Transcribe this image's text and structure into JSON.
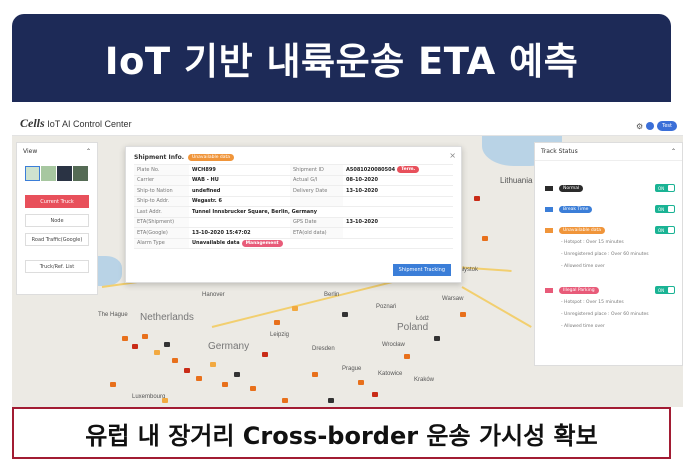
{
  "slide": {
    "title": "IoT 기반 내륙운송 ETA 예측",
    "caption": "유럽 내 장거리 Cross-border 운송 가시성 확보"
  },
  "app": {
    "logo_brand": "Cells",
    "logo_text": "IoT  AI Control Center",
    "header_button": "Test"
  },
  "left_panel": {
    "title": "View",
    "buttons": [
      "Current Truck",
      "Node",
      "Road Traffic(Google)",
      "Truck/Ref. List"
    ]
  },
  "shipment": {
    "title": "Shipment Info.",
    "status_badge": "Unavailable data",
    "rows": [
      {
        "k": "Plate No.",
        "v": "WCH899",
        "k2": "Shipment ID",
        "v2": "A5081020080504",
        "badge": "Term."
      },
      {
        "k": "Carrier",
        "v": "WAB - HU",
        "k2": "Actual G/I",
        "v2": "08-10-2020"
      },
      {
        "k": "Ship-to Nation",
        "v": "undefined",
        "k2": "Delivery Date",
        "v2": "13-10-2020"
      },
      {
        "k": "Ship-to Addr.",
        "v": "Wegastr. 6",
        "k2": "",
        "v2": ""
      },
      {
        "k": "Last Addr.",
        "wide": "Tunnel Innsbrucker Square, Berlin, Germany"
      },
      {
        "k": "ETA(Shipment)",
        "v": "",
        "k2": "GPS Date",
        "v2": "13-10-2020"
      },
      {
        "k": "ETA(Google)",
        "v": "13-10-2020 15:47:02",
        "k2": "ETA(old data)",
        "v2": ""
      },
      {
        "k": "Alarm Type",
        "v": "Unavailable data",
        "badge_v": "Management"
      }
    ],
    "track_button": "Shipment Tracking"
  },
  "track_status": {
    "title": "Track Status",
    "items": [
      {
        "label": "Normal",
        "color": "#2b2b2b",
        "toggle": "ON"
      },
      {
        "label": "Break Time",
        "color": "#3b7ed8",
        "toggle": "ON"
      },
      {
        "label": "Unavailable data",
        "color": "#f0953a",
        "toggle": "ON",
        "subs": [
          "- Hotspot : Over 15 minutes",
          "- Unregistered place : Over 60 minutes",
          "- Allowed time over"
        ]
      },
      {
        "label": "Illegal Parking",
        "color": "#e85b79",
        "toggle": "ON",
        "subs": [
          "- Hotspot : Over 15 minutes",
          "- Unregistered place : Over 60 minutes",
          "- Allowed time over"
        ]
      }
    ]
  },
  "map": {
    "cities": [
      "Lithuania",
      "Białystok",
      "The Hague",
      "Netherlands",
      "Germany",
      "Luxembourg",
      "Hanover",
      "Berlin",
      "Poland",
      "Prague",
      "Katowice",
      "Kraków",
      "Leipzig",
      "Łódź",
      "Poznań",
      "Warsaw",
      "Wrocław",
      "Dresden"
    ]
  }
}
